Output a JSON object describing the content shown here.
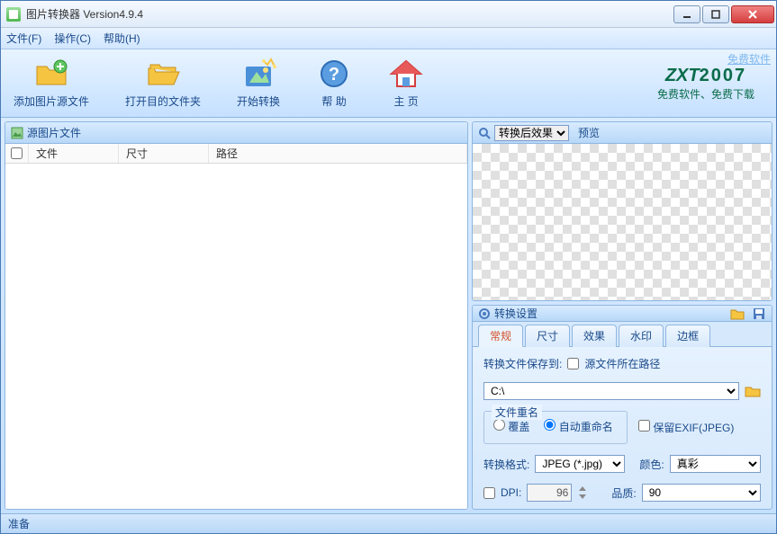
{
  "window": {
    "title": "图片转换器 Version4.9.4"
  },
  "menu": {
    "file": "文件(F)",
    "operate": "操作(C)",
    "help": "帮助(H)"
  },
  "toolbar": {
    "add_source": "添加图片源文件",
    "open_dest": "打开目的文件夹",
    "start_convert": "开始转换",
    "help": "帮 助",
    "home": "主 页",
    "free_link": "免费软件"
  },
  "logo": {
    "brand_left": "ZXT",
    "brand_right": "2007",
    "sub": "免费软件、免费下载"
  },
  "left_pane": {
    "title": "源图片文件",
    "columns": {
      "file": "文件",
      "size": "尺寸",
      "path": "路径"
    }
  },
  "preview": {
    "select_label": "转换后效果",
    "label": "预览"
  },
  "settings": {
    "title": "转换设置",
    "tabs": {
      "general": "常规",
      "size": "尺寸",
      "effect": "效果",
      "watermark": "水印",
      "border": "边框"
    },
    "save_to_label": "转换文件保存到:",
    "source_path_check": "源文件所在路径",
    "path_value": "C:\\",
    "rename_legend": "文件重名",
    "overwrite": "覆盖",
    "auto_rename": "自动重命名",
    "keep_exif": "保留EXIF(JPEG)",
    "format_label": "转换格式:",
    "format_value": "JPEG (*.jpg)",
    "color_label": "颜色:",
    "color_value": "真彩",
    "dpi_label": "DPI:",
    "dpi_value": "96",
    "quality_label": "品质:",
    "quality_value": "90"
  },
  "status": {
    "text": "准备"
  }
}
